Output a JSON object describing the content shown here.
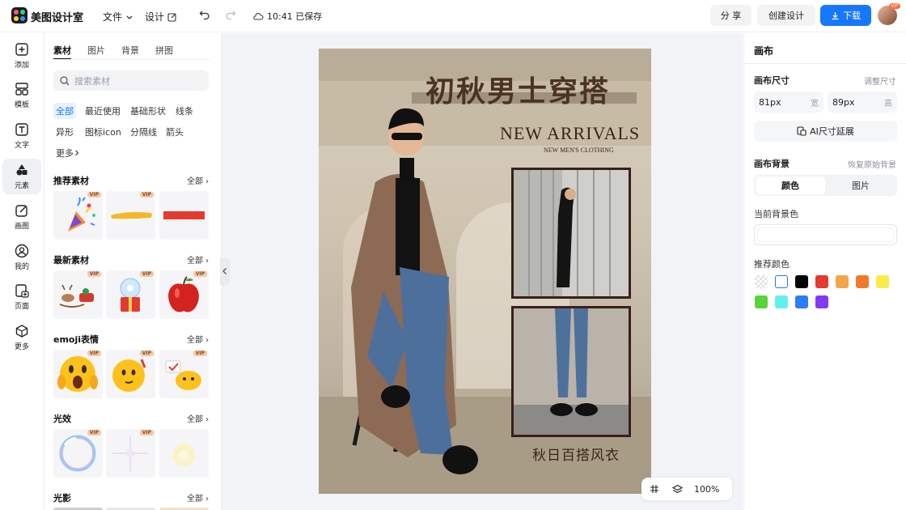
{
  "app": {
    "brand": "美图设计室"
  },
  "topbar": {
    "file_menu": "文件",
    "design_menu": "设计",
    "save_status": "10:41 已保存",
    "share_label": "分 享",
    "create_label": "创建设计",
    "download_label": "下载",
    "avatar_badge": "VIP"
  },
  "rail": [
    {
      "label": "添加",
      "icon": "plus-square-icon"
    },
    {
      "label": "模板",
      "icon": "template-icon"
    },
    {
      "label": "文字",
      "icon": "text-icon"
    },
    {
      "label": "元素",
      "icon": "shapes-icon"
    },
    {
      "label": "画图",
      "icon": "pen-icon"
    },
    {
      "label": "我的",
      "icon": "user-icon"
    },
    {
      "label": "页面",
      "icon": "page-add-icon"
    },
    {
      "label": "更多",
      "icon": "cube-icon"
    }
  ],
  "panel": {
    "tabs": [
      "素材",
      "图片",
      "背景",
      "拼图"
    ],
    "search_placeholder": "搜索素材",
    "chips": [
      "全部",
      "最近使用",
      "基础形状",
      "线条",
      "异形",
      "图标icon",
      "分隔线",
      "箭头",
      "更多"
    ],
    "all_label": "全部",
    "vip": "VIP",
    "sections": [
      "推荐素材",
      "最新素材",
      "emoji表情",
      "光效",
      "光影"
    ]
  },
  "poster": {
    "title": "初秋男士穿搭",
    "headline": "NEW ARRIVALS",
    "subline": "NEW MEN'S CLOTHING",
    "caption": "秋日百搭风衣"
  },
  "zoom": {
    "value": "100%"
  },
  "inspector": {
    "title": "画布",
    "size_label": "画布尺寸",
    "resize_link": "调整尺寸",
    "width_value": "81px",
    "width_unit": "宽",
    "height_value": "89px",
    "height_unit": "高",
    "ai_button": "AI尺寸延展",
    "bg_label": "画布背景",
    "restore_link": "恢复原始背景",
    "seg_color": "颜色",
    "seg_image": "图片",
    "current_bg": "当前背景色",
    "recommended": "推荐颜色",
    "colors": [
      "#ffffff",
      "#000000",
      "#e53a2f",
      "#f4a44a",
      "#f07a2a",
      "#f9ec46",
      "#5ad23c",
      "#63f0ea",
      "#2d7ef2",
      "#7f3cf0"
    ]
  }
}
